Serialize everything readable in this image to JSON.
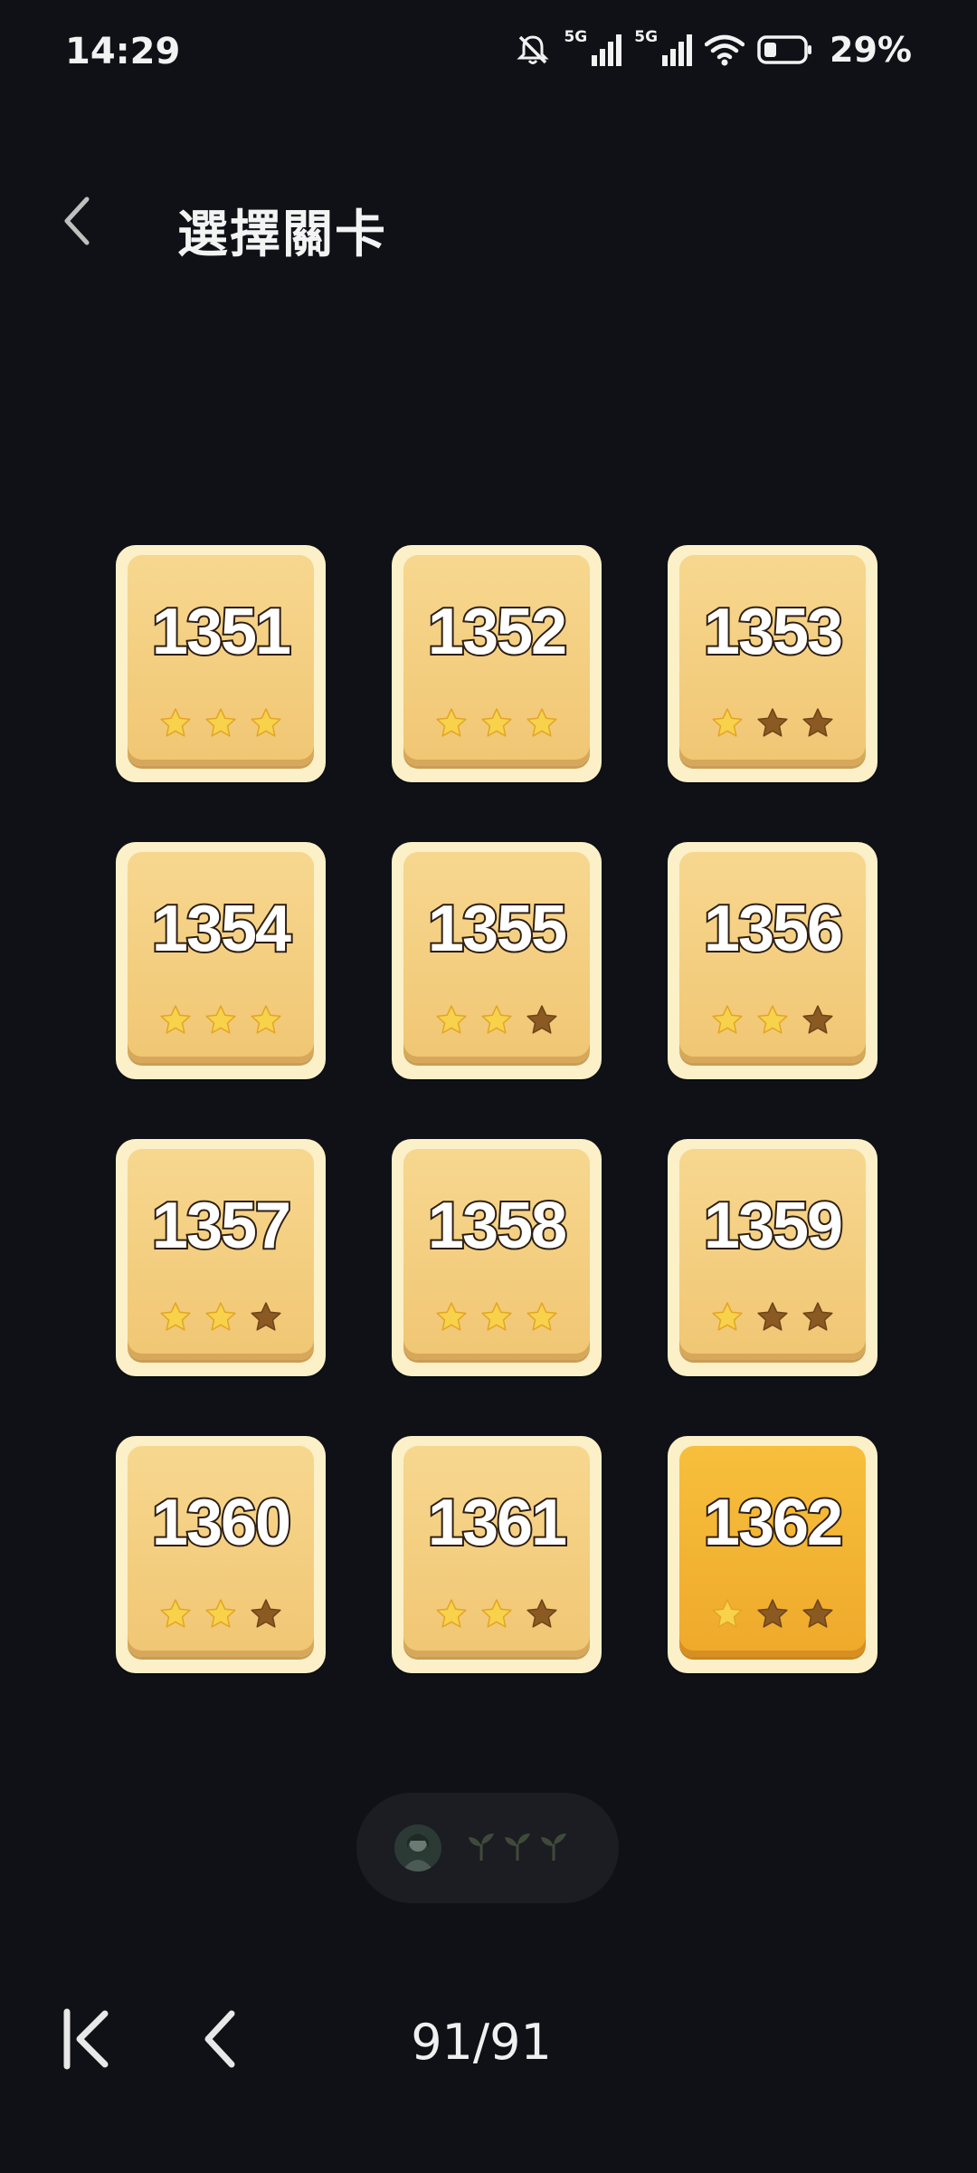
{
  "status_bar": {
    "time": "14:29",
    "network_1": "5G",
    "network_2": "5G",
    "battery_percent": "29%",
    "battery_level": 0.29,
    "icons": [
      "mute-icon",
      "signal-icon",
      "signal-icon",
      "wifi-icon",
      "battery-icon"
    ]
  },
  "header": {
    "back_icon": "chevron-left-icon",
    "title": "選擇關卡"
  },
  "levels": [
    {
      "number": "1351",
      "stars": 3,
      "current": false
    },
    {
      "number": "1352",
      "stars": 3,
      "current": false
    },
    {
      "number": "1353",
      "stars": 1,
      "current": false
    },
    {
      "number": "1354",
      "stars": 3,
      "current": false
    },
    {
      "number": "1355",
      "stars": 2,
      "current": false
    },
    {
      "number": "1356",
      "stars": 2,
      "current": false
    },
    {
      "number": "1357",
      "stars": 2,
      "current": false
    },
    {
      "number": "1358",
      "stars": 3,
      "current": false
    },
    {
      "number": "1359",
      "stars": 1,
      "current": false
    },
    {
      "number": "1360",
      "stars": 2,
      "current": false
    },
    {
      "number": "1361",
      "stars": 2,
      "current": false
    },
    {
      "number": "1362",
      "stars": 1,
      "current": true
    }
  ],
  "colors": {
    "star_filled": "#f7d24a",
    "star_empty": "#8a5a22",
    "tile_normal": "#f0c673",
    "tile_current": "#efa92b"
  },
  "floating_pill": {
    "icons": [
      "avatar-icon",
      "sprout-icon",
      "sprout-icon",
      "sprout-icon"
    ]
  },
  "bottom_nav": {
    "first_icon": "skip-to-first-icon",
    "prev_icon": "chevron-left-icon",
    "page_indicator": "91/91"
  }
}
